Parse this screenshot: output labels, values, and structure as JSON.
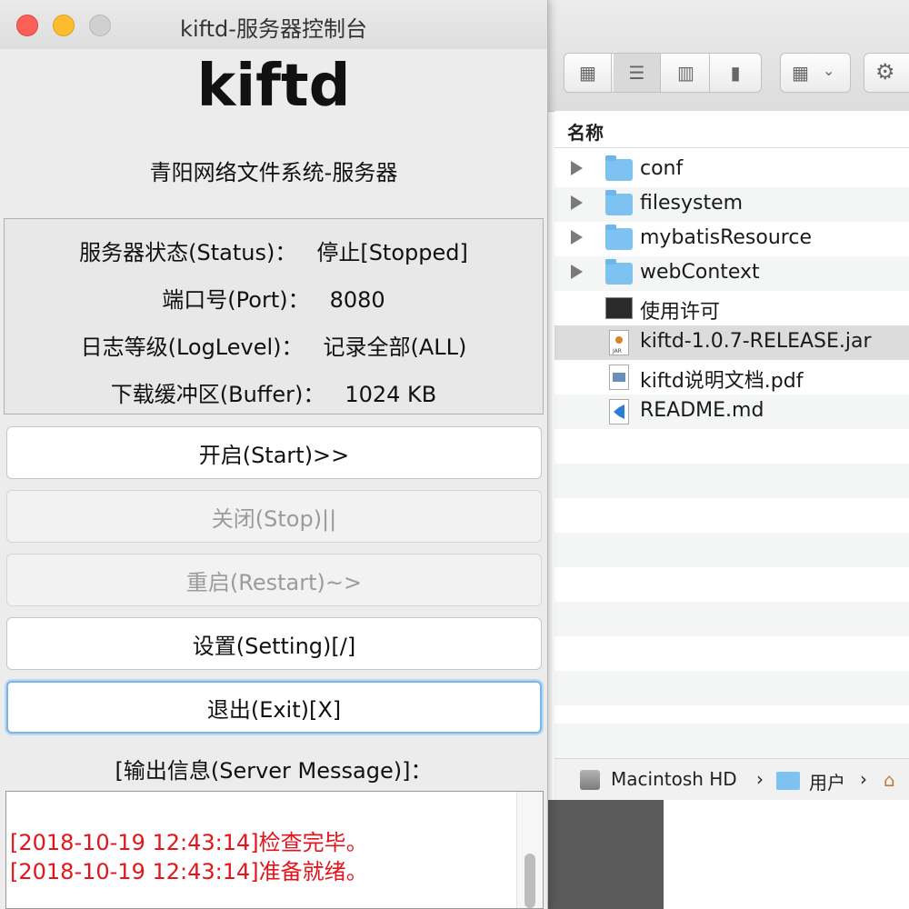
{
  "window": {
    "title": "kiftd-服务器控制台"
  },
  "app": {
    "title": "kiftd",
    "subtitle": "青阳网络文件系统-服务器"
  },
  "status": {
    "server_status_label": "服务器状态(Status)：",
    "server_status_value": "停止[Stopped]",
    "port_label": "端口号(Port)：",
    "port_value": "8080",
    "log_level_label": "日志等级(LogLevel)：",
    "log_level_value": "记录全部(ALL)",
    "buffer_label": "下载缓冲区(Buffer)：",
    "buffer_value": "1024 KB"
  },
  "buttons": {
    "start": "开启(Start)>>",
    "stop": "关闭(Stop)||",
    "restart": "重启(Restart)~>",
    "setting": "设置(Setting)[/]",
    "exit": "退出(Exit)[X]"
  },
  "messages": {
    "label": "[输出信息(Server Message)]：",
    "lines": [
      "[2018-10-19 12:43:14]检查完毕。",
      "[2018-10-19 12:43:14]准备就绪。"
    ],
    "color": "#e2141c"
  },
  "finder": {
    "column_header": "名称",
    "files": [
      {
        "name": "conf",
        "icon": "folder-icon",
        "expandable": true
      },
      {
        "name": "filesystem",
        "icon": "folder-icon",
        "expandable": true
      },
      {
        "name": "mybatisResource",
        "icon": "folder-icon",
        "expandable": true
      },
      {
        "name": "webContext",
        "icon": "folder-icon",
        "expandable": true
      },
      {
        "name": "使用许可",
        "icon": "terminal-icon",
        "expandable": false
      },
      {
        "name": "kiftd-1.0.7-RELEASE.jar",
        "icon": "jar-icon",
        "expandable": false,
        "selected": true
      },
      {
        "name": "kiftd说明文档.pdf",
        "icon": "pdf-icon",
        "expandable": false
      },
      {
        "name": "README.md",
        "icon": "vscode-doc-icon",
        "expandable": false
      }
    ],
    "path": [
      "Macintosh HD",
      "用户"
    ]
  }
}
